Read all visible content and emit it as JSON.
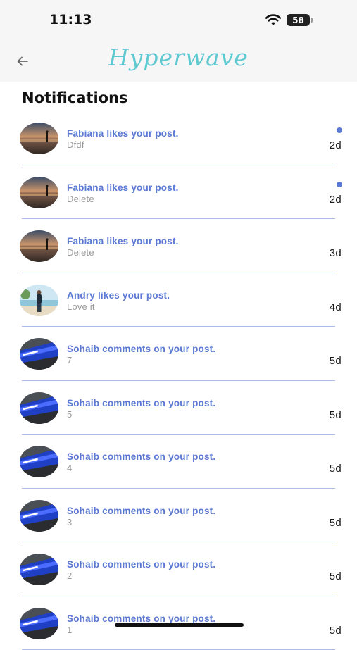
{
  "status_bar": {
    "time": "11:13",
    "battery": "58"
  },
  "app_bar": {
    "brand": "Hyperwave"
  },
  "heading": "Notifications",
  "notifications": [
    {
      "title": "Fabiana likes your post.",
      "subtitle": "Dfdf",
      "age": "2d",
      "unread": true,
      "avatar": "sunset-beach-photo"
    },
    {
      "title": "Fabiana likes your post.",
      "subtitle": "Delete",
      "age": "2d",
      "unread": true,
      "avatar": "sunset-beach-photo"
    },
    {
      "title": "Fabiana likes your post.",
      "subtitle": "Delete",
      "age": "3d",
      "unread": false,
      "avatar": "sunset-beach-photo"
    },
    {
      "title": "Andry likes your post.",
      "subtitle": "Love it",
      "age": "4d",
      "unread": false,
      "avatar": "beach-person-photo"
    },
    {
      "title": "Sohaib comments on your post.",
      "subtitle": "7",
      "age": "5d",
      "unread": false,
      "avatar": "led-sign-photo"
    },
    {
      "title": "Sohaib comments on your post.",
      "subtitle": "5",
      "age": "5d",
      "unread": false,
      "avatar": "led-sign-photo"
    },
    {
      "title": "Sohaib comments on your post.",
      "subtitle": "4",
      "age": "5d",
      "unread": false,
      "avatar": "led-sign-photo"
    },
    {
      "title": "Sohaib comments on your post.",
      "subtitle": "3",
      "age": "5d",
      "unread": false,
      "avatar": "led-sign-photo"
    },
    {
      "title": "Sohaib comments on your post.",
      "subtitle": "2",
      "age": "5d",
      "unread": false,
      "avatar": "led-sign-photo"
    },
    {
      "title": "Sohaib comments on your post.",
      "subtitle": "1",
      "age": "5d",
      "unread": false,
      "avatar": "led-sign-photo"
    }
  ],
  "colors": {
    "accent": "#5b78d3",
    "brand": "#5ec9d0",
    "divider": "#aabbe8"
  }
}
